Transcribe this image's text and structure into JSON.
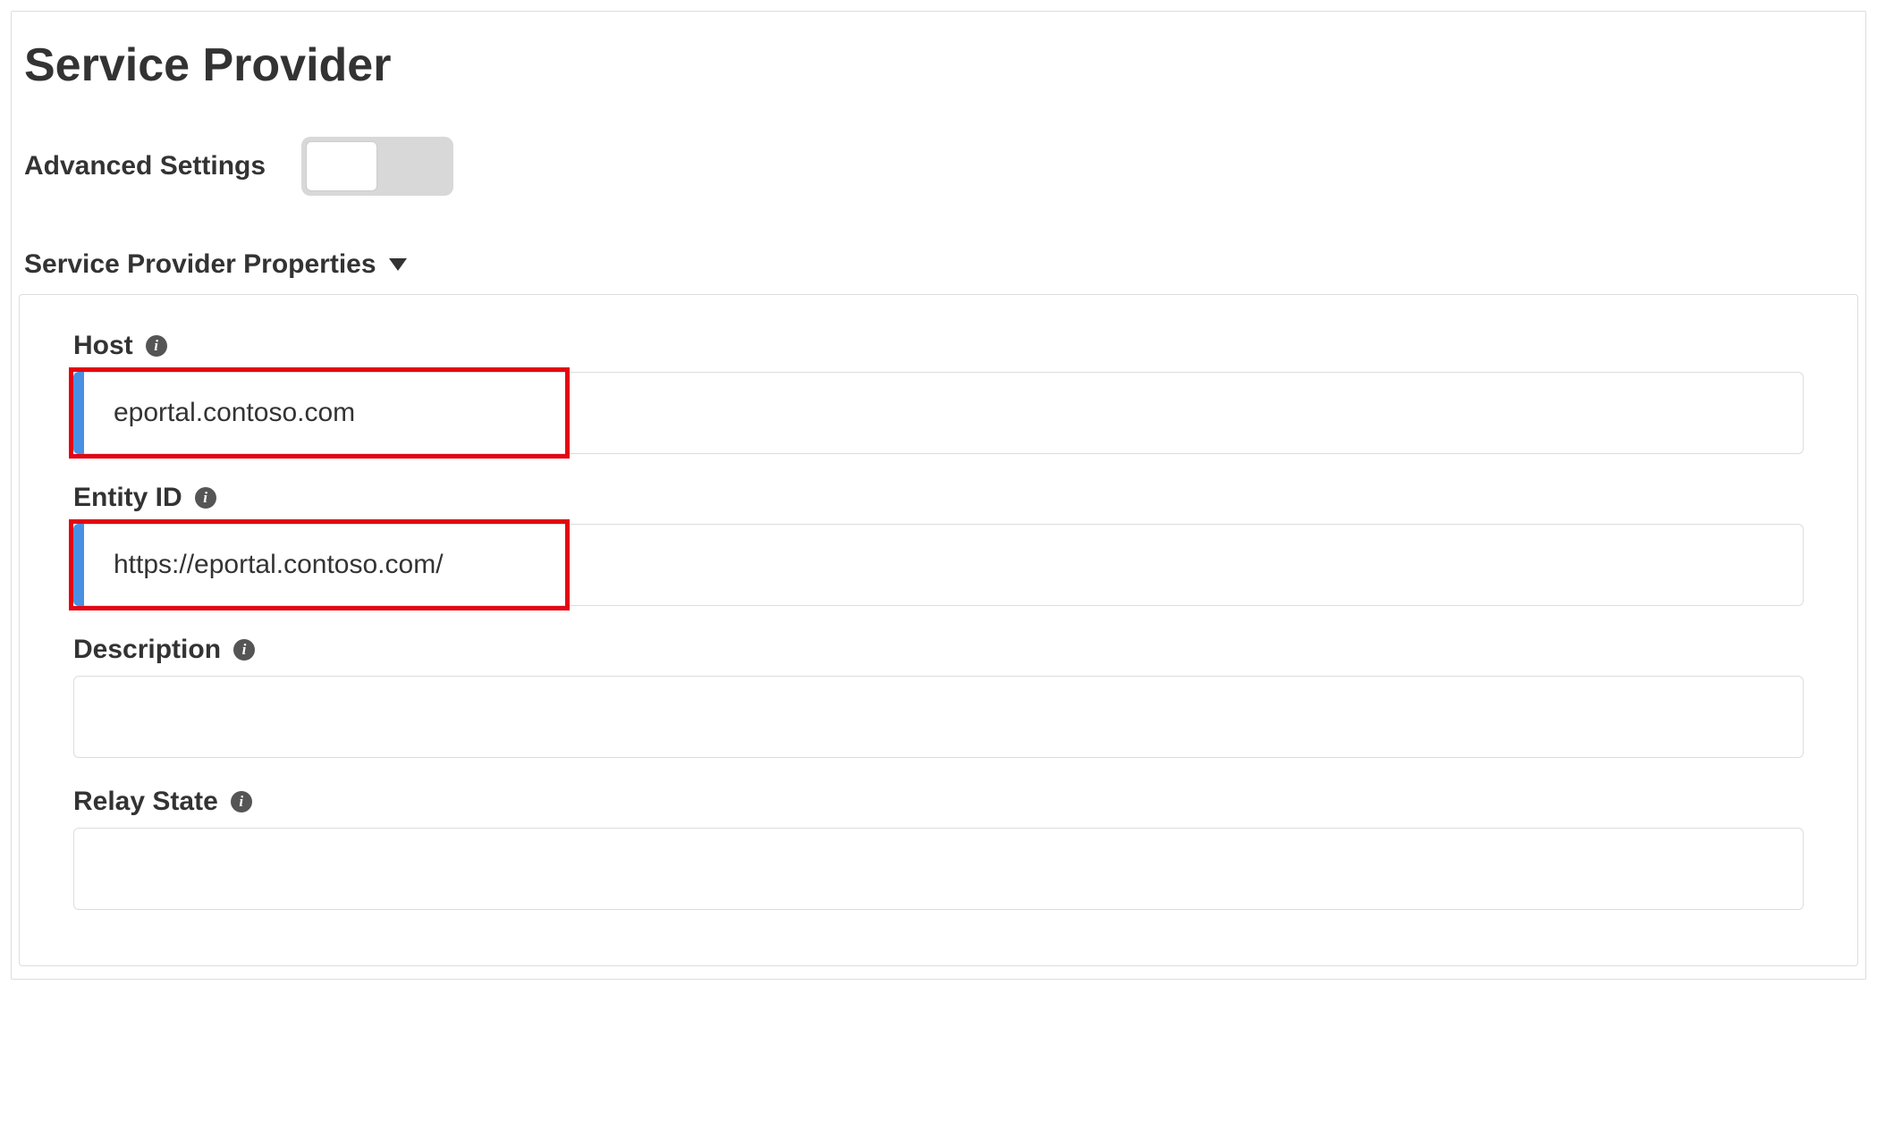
{
  "page": {
    "title": "Service Provider"
  },
  "advanced_settings": {
    "label": "Advanced Settings",
    "enabled": false
  },
  "section": {
    "title": "Service Provider Properties"
  },
  "fields": {
    "host": {
      "label": "Host",
      "value": "eportal.contoso.com"
    },
    "entity_id": {
      "label": "Entity ID",
      "value": "https://eportal.contoso.com/"
    },
    "description": {
      "label": "Description",
      "value": ""
    },
    "relay_state": {
      "label": "Relay State",
      "value": ""
    }
  }
}
